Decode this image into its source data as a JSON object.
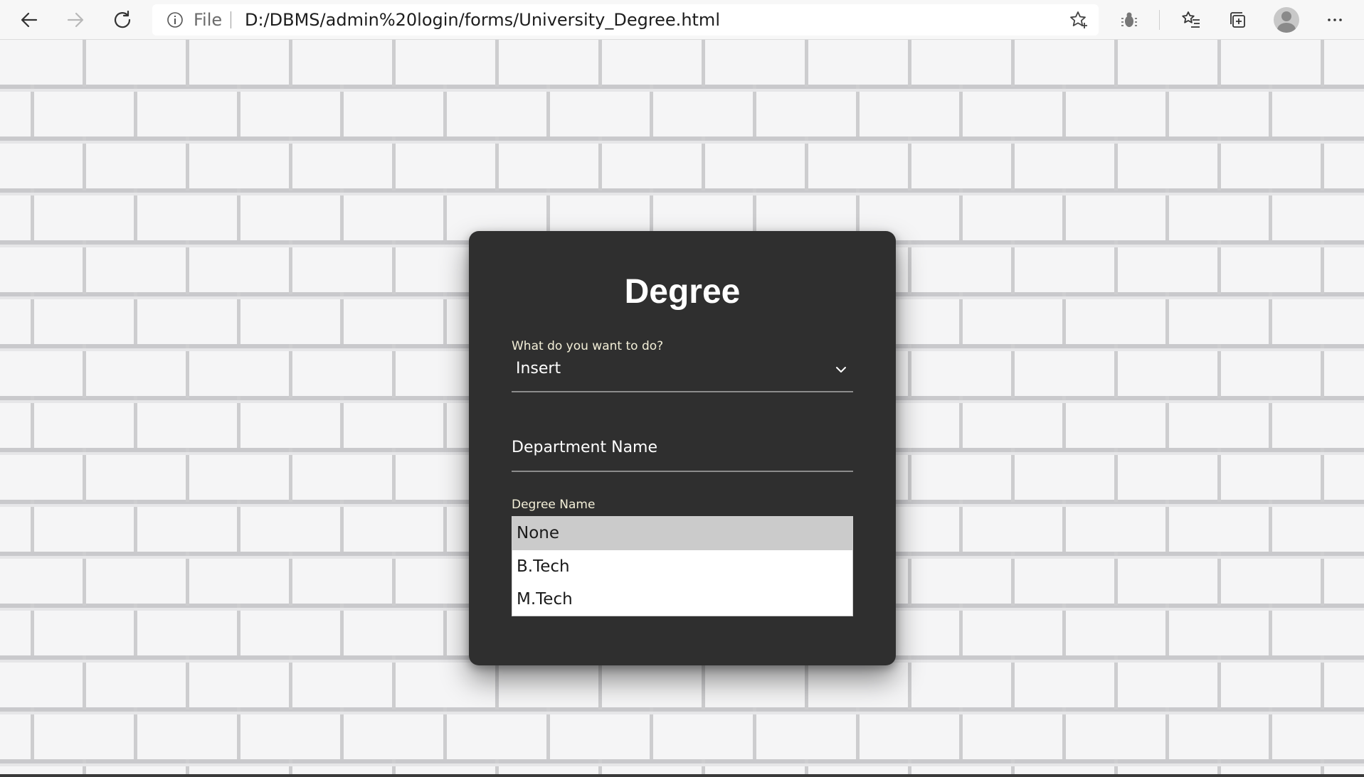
{
  "browser": {
    "back_icon": "arrow-left-icon",
    "forward_icon": "arrow-right-icon",
    "refresh_icon": "refresh-icon",
    "address_bar": {
      "info_icon": "info-icon",
      "scheme_label": "File",
      "url": "D:/DBMS/admin%20login/forms/University_Degree.html",
      "favorite_icon": "star-add-icon"
    },
    "toolbar_icons": [
      "bug-icon",
      "favorites-icon",
      "collections-icon",
      "profile-avatar",
      "more-icon"
    ]
  },
  "form": {
    "title": "Degree",
    "action_field": {
      "label": "What do you want to do?",
      "value": "Insert"
    },
    "department_field": {
      "placeholder": "Department Name"
    },
    "degree_field": {
      "label": "Degree Name",
      "value": ""
    },
    "degree_options": [
      {
        "label": "None",
        "highlighted": true
      },
      {
        "label": "B.Tech",
        "highlighted": false
      },
      {
        "label": "M.Tech",
        "highlighted": false
      }
    ]
  },
  "colors": {
    "card_bg": "#2f2f2f",
    "label_color": "#f3efd8",
    "dropdown_highlight": "#cbcbcb"
  }
}
